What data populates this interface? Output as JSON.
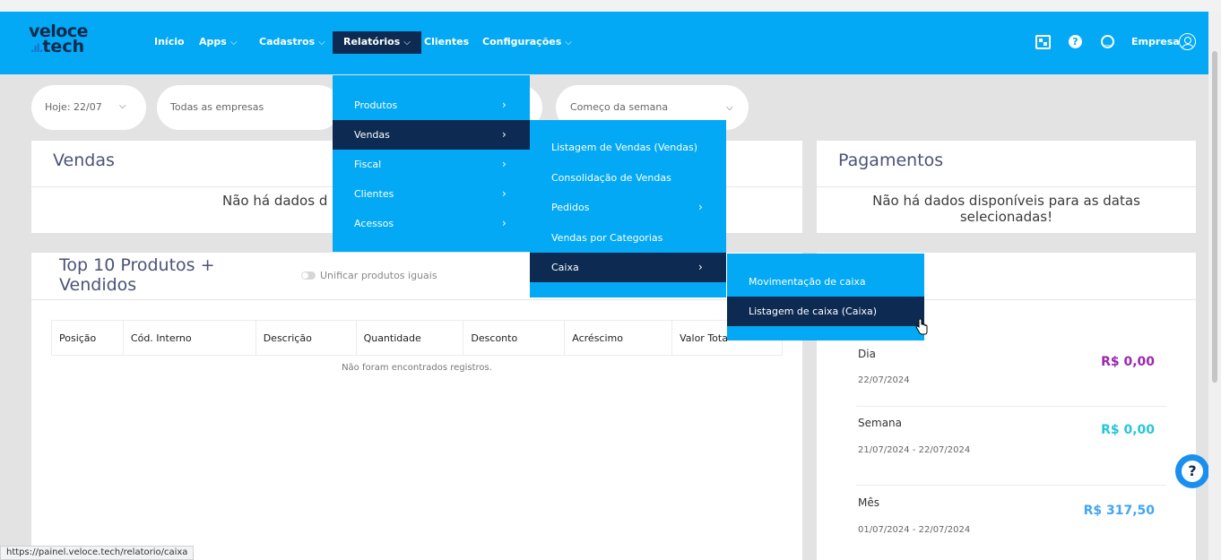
{
  "navbar": {
    "logo_line1": "veloce",
    "logo_line2": "tech",
    "items": [
      {
        "label": "Início",
        "has_dropdown": false
      },
      {
        "label": "Apps",
        "has_dropdown": true
      },
      {
        "label": "Cadastros",
        "has_dropdown": true
      },
      {
        "label": "Relatórios",
        "has_dropdown": true,
        "active": true
      },
      {
        "label": "Clientes",
        "has_dropdown": false
      },
      {
        "label": "Configurações",
        "has_dropdown": true
      }
    ],
    "user_label": "Empresa",
    "icons": [
      "grid-box-icon",
      "help-icon",
      "smiley-icon",
      "user-circle-icon"
    ]
  },
  "filters": {
    "date": "Hoje: 22/07",
    "company": "Todas as empresas",
    "period": "Começo da semana"
  },
  "vendas_card": {
    "title": "Vendas",
    "empty_message": "Não há dados d"
  },
  "pagamentos_card": {
    "title": "Pagamentos",
    "empty_message_line1": "Não há dados disponíveis para as datas",
    "empty_message_line2": "selecionadas!"
  },
  "top_products": {
    "title_line1": "Top 10 Produtos +",
    "title_line2": "Vendidos",
    "toggle_label": "Unificar produtos iguais",
    "columns": [
      "Posição",
      "Cód. Interno",
      "Descrição",
      "Quantidade",
      "Desconto",
      "Acréscimo",
      "Valor Tota"
    ],
    "no_records": "Não foram encontrados registros."
  },
  "summary": {
    "periods": [
      {
        "label": "Dia",
        "date": "22/07/2024",
        "value": "R$ 0,00",
        "color": "#9c27b0"
      },
      {
        "label": "Semana",
        "date": "21/07/2024 - 22/07/2024",
        "value": "R$ 0,00",
        "color": "#26c6da"
      },
      {
        "label": "Mês",
        "date": "01/07/2024 - 22/07/2024",
        "value": "R$ 317,50",
        "color": "#42a5f5"
      }
    ]
  },
  "menu_relatorios": {
    "items": [
      {
        "label": "Produtos"
      },
      {
        "label": "Vendas",
        "active": true
      },
      {
        "label": "Fiscal"
      },
      {
        "label": "Clientes"
      },
      {
        "label": "Acessos"
      }
    ],
    "arrow": ">"
  },
  "menu_vendas": {
    "items": [
      {
        "label": "Listagem de Vendas (Vendas)",
        "has_submenu": false
      },
      {
        "label": "Consolidação de Vendas",
        "has_submenu": false
      },
      {
        "label": "Pedidos",
        "has_submenu": true
      },
      {
        "label": "Vendas por Categorias",
        "has_submenu": false
      },
      {
        "label": "Caixa",
        "has_submenu": true,
        "active": true
      }
    ]
  },
  "menu_caixa": {
    "items": [
      {
        "label": "Movimentação de caixa"
      },
      {
        "label": "Listagem de caixa (Caixa)",
        "active": true
      }
    ]
  },
  "help_button": "?",
  "status_url": "https://painel.veloce.tech/relatorio/caixa",
  "colors": {
    "navbar": "#03a9f4",
    "active": "#0d2b52",
    "background": "#e3e3e3"
  }
}
